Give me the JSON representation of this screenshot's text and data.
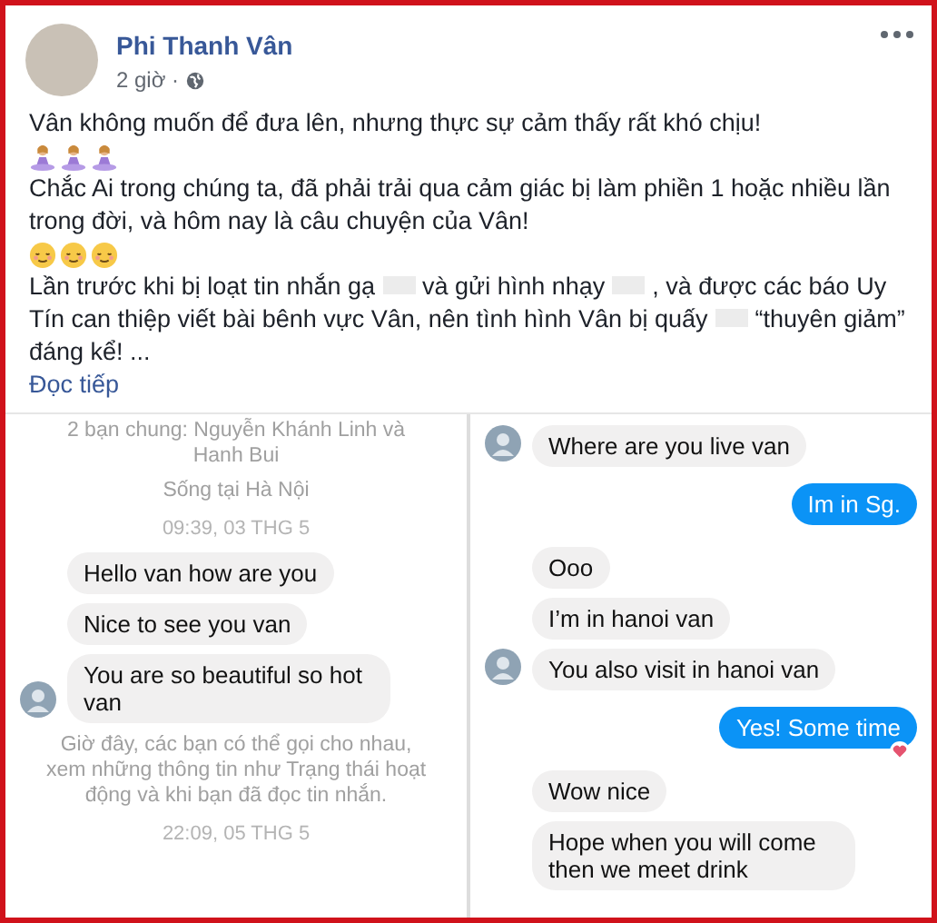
{
  "post": {
    "author": "Phi Thanh Vân",
    "time": "2 giờ ·",
    "paragraphs": [
      {
        "kind": "text",
        "text": "Vân không muốn để đưa lên, nhưng thực sự cảm thấy rất khó chịu!"
      },
      {
        "kind": "emoji-person"
      },
      {
        "kind": "text",
        "text": "Chắc Ai trong chúng ta, đã phải trải qua cảm giác bị làm phiền 1 hoặc nhiều lần trong đời, và hôm nay là câu chuyện của Vân!"
      },
      {
        "kind": "emoji-face"
      },
      {
        "kind": "blurred",
        "parts": [
          "Lần trước khi bị loạt tin nhắn gạ",
          "và gửi hình nhạy",
          ", và được các báo Uy Tín can thiệp viết bài bênh vực Vân, nên tình hình Vân bị quấy",
          "“thuyên giảm” đáng kể! ..."
        ]
      }
    ],
    "read_more": "Đọc tiếp"
  },
  "left_chat": {
    "items": [
      {
        "kind": "info",
        "text": "2 bạn chung: Nguyễn Khánh Linh và Hanh Bui"
      },
      {
        "kind": "info",
        "text": "Sống tại Hà Nội"
      },
      {
        "kind": "time",
        "text": "09:39, 03 THG 5"
      },
      {
        "kind": "in",
        "text": "Hello van how are you",
        "avatar": false
      },
      {
        "kind": "in",
        "text": "Nice to see you van",
        "avatar": false
      },
      {
        "kind": "in",
        "text": "You are so beautiful so hot van",
        "avatar": true
      },
      {
        "kind": "info",
        "text": "Giờ đây, các bạn có thể gọi cho nhau, xem những thông tin như Trạng thái hoạt động và khi bạn đã đọc tin nhắn."
      },
      {
        "kind": "time",
        "text": "22:09, 05 THG 5"
      }
    ]
  },
  "right_chat": {
    "items": [
      {
        "kind": "in",
        "text": "Where are you live van",
        "avatar": true
      },
      {
        "kind": "out",
        "text": "Im in Sg.",
        "reaction": false
      },
      {
        "kind": "in",
        "text": "Ooo",
        "avatar": false
      },
      {
        "kind": "in",
        "text": "I’m in hanoi van",
        "avatar": false
      },
      {
        "kind": "in",
        "text": "You also visit in hanoi van",
        "avatar": true
      },
      {
        "kind": "out",
        "text": "Yes! Some time",
        "reaction": true
      },
      {
        "kind": "in",
        "text": "Wow nice",
        "avatar": false
      },
      {
        "kind": "in",
        "text": "Hope when you will come then we meet drink",
        "avatar": false
      }
    ]
  }
}
